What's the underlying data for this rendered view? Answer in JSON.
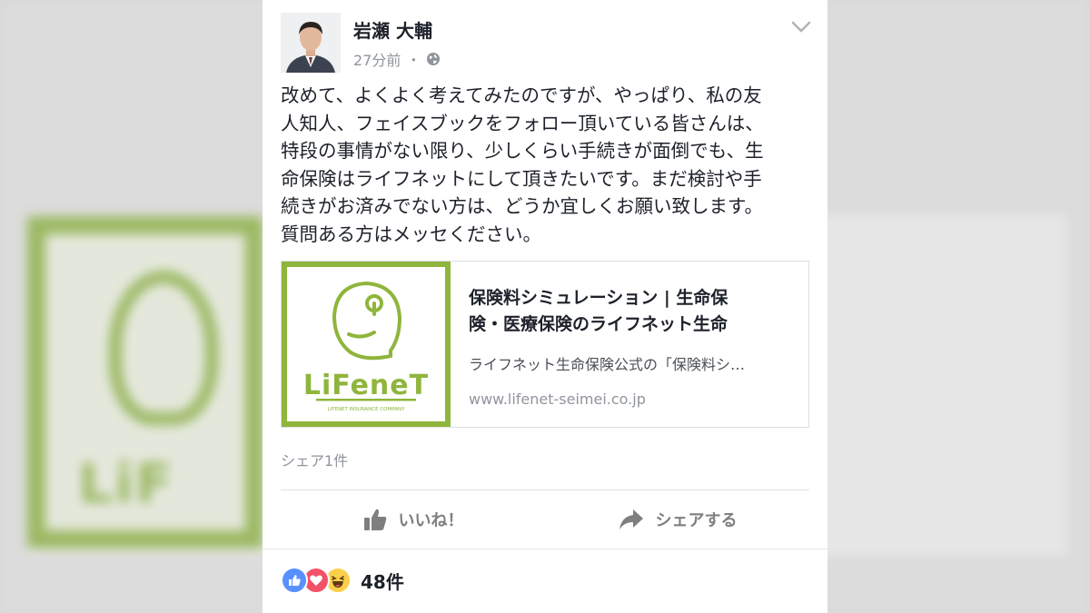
{
  "post": {
    "author": "岩瀬 大輔",
    "time": "27分前",
    "separator": "・",
    "body_lines": [
      "改めて、よくよく考えてみたのですが、やっぱり、私の友",
      "人知人、フェイスブックをフォロー頂いている皆さんは、",
      "特段の事情がない限り、少しくらい手続きが面倒でも、生",
      "命保険はライフネットにして頂きたいです。まだ検討や手",
      "続きがお済みでない方は、どうか宜しくお願い致します。",
      "質問ある方はメッセください。"
    ],
    "link": {
      "logo_word": "LiFeneT",
      "logo_sub": "LIFENET INSURANCE COMPANY",
      "title_line1": "保険料シミュレーション | 生命保",
      "title_line2": "険・医療保険のライフネット生命",
      "description": "ライフネット生命保険公式の「保険料シ…",
      "domain": "www.lifenet-seimei.co.jp",
      "brand_color": "#8fb53c"
    },
    "share_count": "シェア1件",
    "actions": {
      "like": "いいね！",
      "share": "シェアする"
    },
    "reactions": {
      "icons": [
        "like-icon",
        "love-icon",
        "haha-icon"
      ],
      "count": "48件"
    }
  }
}
